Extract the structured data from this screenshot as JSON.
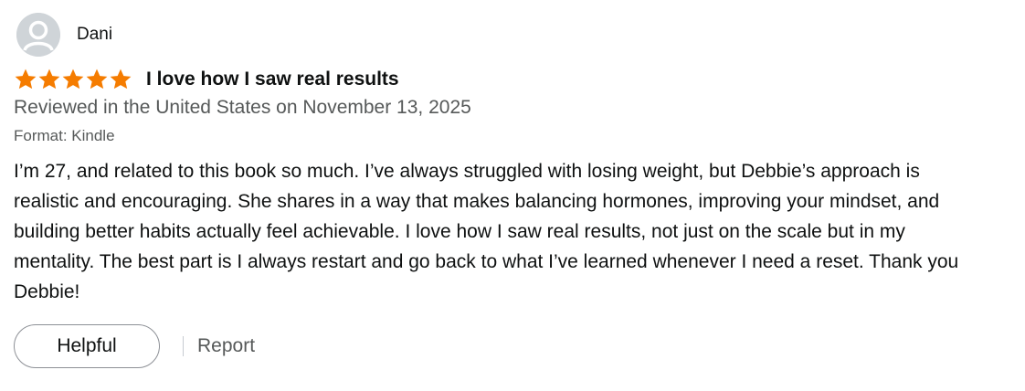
{
  "review": {
    "reviewer_name": "Dani",
    "rating": 5,
    "title": "I love how I saw real results",
    "date_line": "Reviewed in the United States on November 13, 2025",
    "format": "Format: Kindle",
    "body": "I’m 27, and related to this book so much. I’ve always struggled with losing weight, but Debbie’s approach is realistic and encouraging. She shares in a way that makes balancing hormones, improving your mindset, and building better habits actually feel achievable. I love how I saw real results, not just on the scale but in my mentality. The best part is I always restart and go back to what I’ve learned whenever I need a reset. Thank you Debbie!"
  },
  "actions": {
    "helpful_label": "Helpful",
    "report_label": "Report"
  },
  "colors": {
    "star": "#f57c00",
    "secondary_text": "#565959",
    "avatar_bg": "#cfd4d8"
  },
  "icons": {
    "avatar": "default-user-avatar-icon",
    "star": "star-icon"
  }
}
